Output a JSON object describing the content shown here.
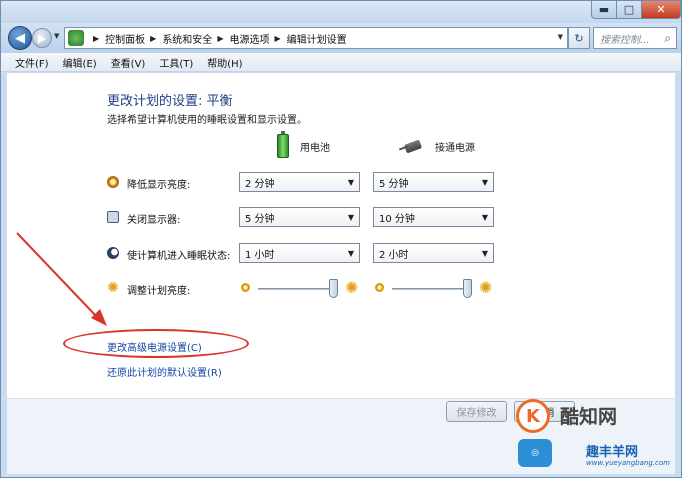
{
  "window": {
    "minimize_glyph": "▬",
    "maximize_glyph": "□",
    "close_glyph": "✕"
  },
  "nav": {
    "back_glyph": "◀",
    "forward_glyph": "▶",
    "dropdown_glyph": "▼",
    "breadcrumb": [
      "控制面板",
      "系统和安全",
      "电源选项",
      "编辑计划设置"
    ],
    "crumb_separator": "▶",
    "refresh_glyph": "↻",
    "search_placeholder": "搜索控制...",
    "search_icon": "search-icon"
  },
  "menu": {
    "items": [
      "文件(F)",
      "编辑(E)",
      "查看(V)",
      "工具(T)",
      "帮助(H)"
    ]
  },
  "page": {
    "title": "更改计划的设置: 平衡",
    "subtitle": "选择希望计算机使用的睡眠设置和显示设置。",
    "columns": {
      "battery": "用电池",
      "plugged": "接通电源"
    },
    "rows": [
      {
        "label": "降低显示亮度:",
        "icon": "brightness-dim-icon",
        "battery": "2 分钟",
        "plugged": "5 分钟"
      },
      {
        "label": "关闭显示器:",
        "icon": "monitor-icon",
        "battery": "5 分钟",
        "plugged": "10 分钟"
      },
      {
        "label": "使计算机进入睡眠状态:",
        "icon": "sleep-icon",
        "battery": "1 小时",
        "plugged": "2 小时"
      }
    ],
    "brightness": {
      "label": "调整计划亮度:",
      "battery_level": 0.92,
      "plugged_level": 0.92
    },
    "links": {
      "advanced": "更改高级电源设置(C)",
      "restore": "还原此计划的默认设置(R)"
    }
  },
  "footer": {
    "save_label": "保存修改",
    "cancel_label": "取消"
  },
  "watermark": {
    "brand": "酷知网",
    "brand2": "趣丰羊网",
    "url": "www.yueyangbang.com",
    "logo_char": "K"
  },
  "colors": {
    "annotation": "#d8342c",
    "title_blue": "#1e3f87",
    "link_blue": "#1646a6"
  }
}
